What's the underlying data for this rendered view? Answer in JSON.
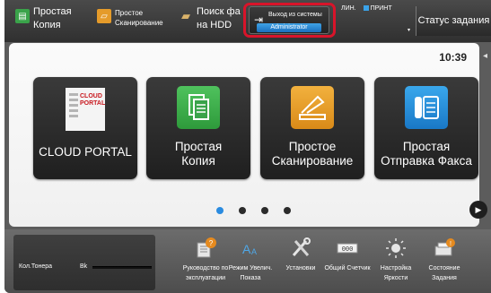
{
  "topbar": {
    "copy_label": "Простая\nКопия",
    "scan_label": "Простое\nСканирование",
    "hdd_label": "Поиск фа\nна HDD",
    "logout_label": "Выход из системы",
    "user_label": "Administrator",
    "status_line": "ЛИН.",
    "print_label": "ПРИНТ",
    "job_status_label": "Статус задания"
  },
  "clock": "10:39",
  "tiles": [
    {
      "label": "CLOUD PORTAL",
      "icon": "cloud-portal-icon"
    },
    {
      "label": "Простая\nКопия",
      "icon": "copy-icon"
    },
    {
      "label": "Простое\nСканирование",
      "icon": "scan-icon"
    },
    {
      "label": "Простая\nОтправка Факса",
      "icon": "fax-icon"
    }
  ],
  "cloud_icon_text": "CLOUD\nPORTAL",
  "pager": {
    "pages": 4,
    "current": 1
  },
  "bottombar": {
    "toner_label": "Кол.Тонера",
    "toner_color": "Bk",
    "items": [
      {
        "label": "Руководство по\nэксплуатации",
        "icon": "manual-icon"
      },
      {
        "label": "Режим Увелич.\nПоказа",
        "icon": "zoom-text-icon"
      },
      {
        "label": "Установки",
        "icon": "settings-icon"
      },
      {
        "label": "Общий Счетчик",
        "icon": "counter-icon"
      },
      {
        "label": "Настройка\nЯркости",
        "icon": "brightness-icon"
      },
      {
        "label": "Состояние\nЗадания",
        "icon": "job-status-icon"
      }
    ]
  },
  "colors": {
    "highlight": "#d8142a",
    "accent_blue": "#2a8be0",
    "copy_green": "#3aa34a",
    "scan_orange": "#e59b2a"
  }
}
